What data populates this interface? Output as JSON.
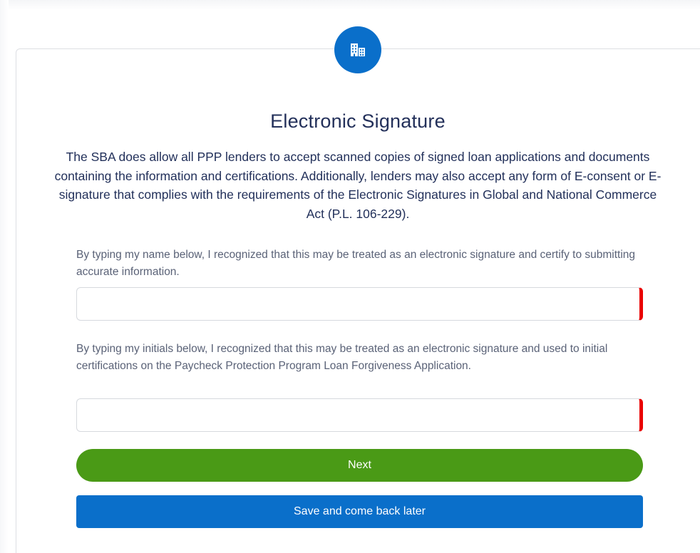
{
  "colors": {
    "brand_blue": "#0a6fca",
    "next_green": "#4a9a16",
    "required_red": "#ea0000",
    "title_navy": "#23305a"
  },
  "header": {
    "icon": "building-icon"
  },
  "form": {
    "title": "Electronic Signature",
    "intro": "The SBA does allow all PPP lenders to accept scanned copies of signed loan applications and documents containing the information and certifications. Additionally, lenders may also accept any form of E-consent or E-signature that complies with the requirements of the Electronic Signatures in Global and National Commerce Act (P.L. 106-229).",
    "name_field": {
      "label": "By typing my name below, I recognized that this may be treated as an electronic signature and certify to submitting accurate information.",
      "value": "",
      "placeholder": ""
    },
    "initials_field": {
      "label": "By typing my initials below, I recognized that this may be treated as an electronic signature and used to initial certifications on the Paycheck Protection Program Loan Forgiveness Application.",
      "value": "",
      "placeholder": ""
    }
  },
  "actions": {
    "next_label": "Next",
    "save_label": "Save and come back later"
  }
}
